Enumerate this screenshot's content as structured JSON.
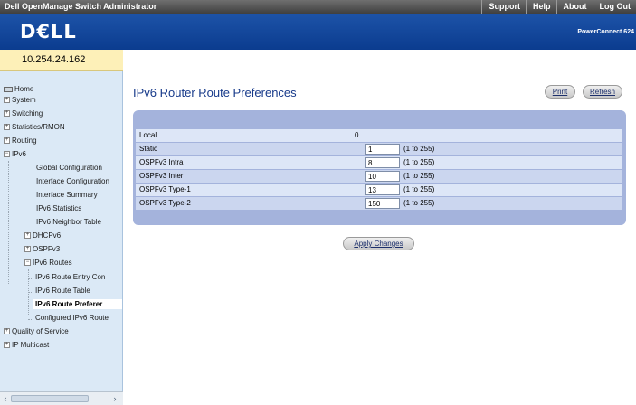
{
  "topbar": {
    "title": "Dell OpenManage Switch Administrator",
    "links": [
      "Support",
      "Help",
      "About",
      "Log Out"
    ]
  },
  "banner": {
    "logo": "D€LL",
    "model": "PowerConnect 624"
  },
  "ip_address": "10.254.24.162",
  "sidebar": {
    "items": [
      {
        "label": "Home"
      },
      {
        "label": "System"
      },
      {
        "label": "Switching"
      },
      {
        "label": "Statistics/RMON"
      },
      {
        "label": "Routing"
      },
      {
        "label": "IPv6"
      },
      {
        "label": "Global Configuration"
      },
      {
        "label": "Interface Configuration"
      },
      {
        "label": "Interface Summary"
      },
      {
        "label": "IPv6 Statistics"
      },
      {
        "label": "IPv6 Neighbor Table"
      },
      {
        "label": "DHCPv6"
      },
      {
        "label": "OSPFv3"
      },
      {
        "label": "IPv6 Routes"
      },
      {
        "label": "IPv6 Route Entry Con"
      },
      {
        "label": "IPv6 Route Table"
      },
      {
        "label": "IPv6 Route Preferer"
      },
      {
        "label": "Configured IPv6 Route"
      },
      {
        "label": "Quality of Service"
      },
      {
        "label": "IP Multicast"
      }
    ]
  },
  "main": {
    "title": "IPv6 Router Route Preferences",
    "print_label": "Print",
    "refresh_label": "Refresh",
    "apply_label": "Apply Changes",
    "rows": [
      {
        "label": "Local",
        "value": "0"
      },
      {
        "label": "Static",
        "value": "1",
        "range": "(1 to 255)"
      },
      {
        "label": "OSPFv3 Intra",
        "value": "8",
        "range": "(1 to 255)"
      },
      {
        "label": "OSPFv3 Inter",
        "value": "10",
        "range": "(1 to 255)"
      },
      {
        "label": "OSPFv3 Type-1",
        "value": "13",
        "range": "(1 to 255)"
      },
      {
        "label": "OSPFv3 Type-2",
        "value": "150",
        "range": "(1 to 255)"
      }
    ]
  },
  "colors": {
    "banner": "#0b3c8f",
    "sidebar": "#dbe9f6",
    "panel": "#a4b3dc",
    "title": "#173a8a"
  }
}
